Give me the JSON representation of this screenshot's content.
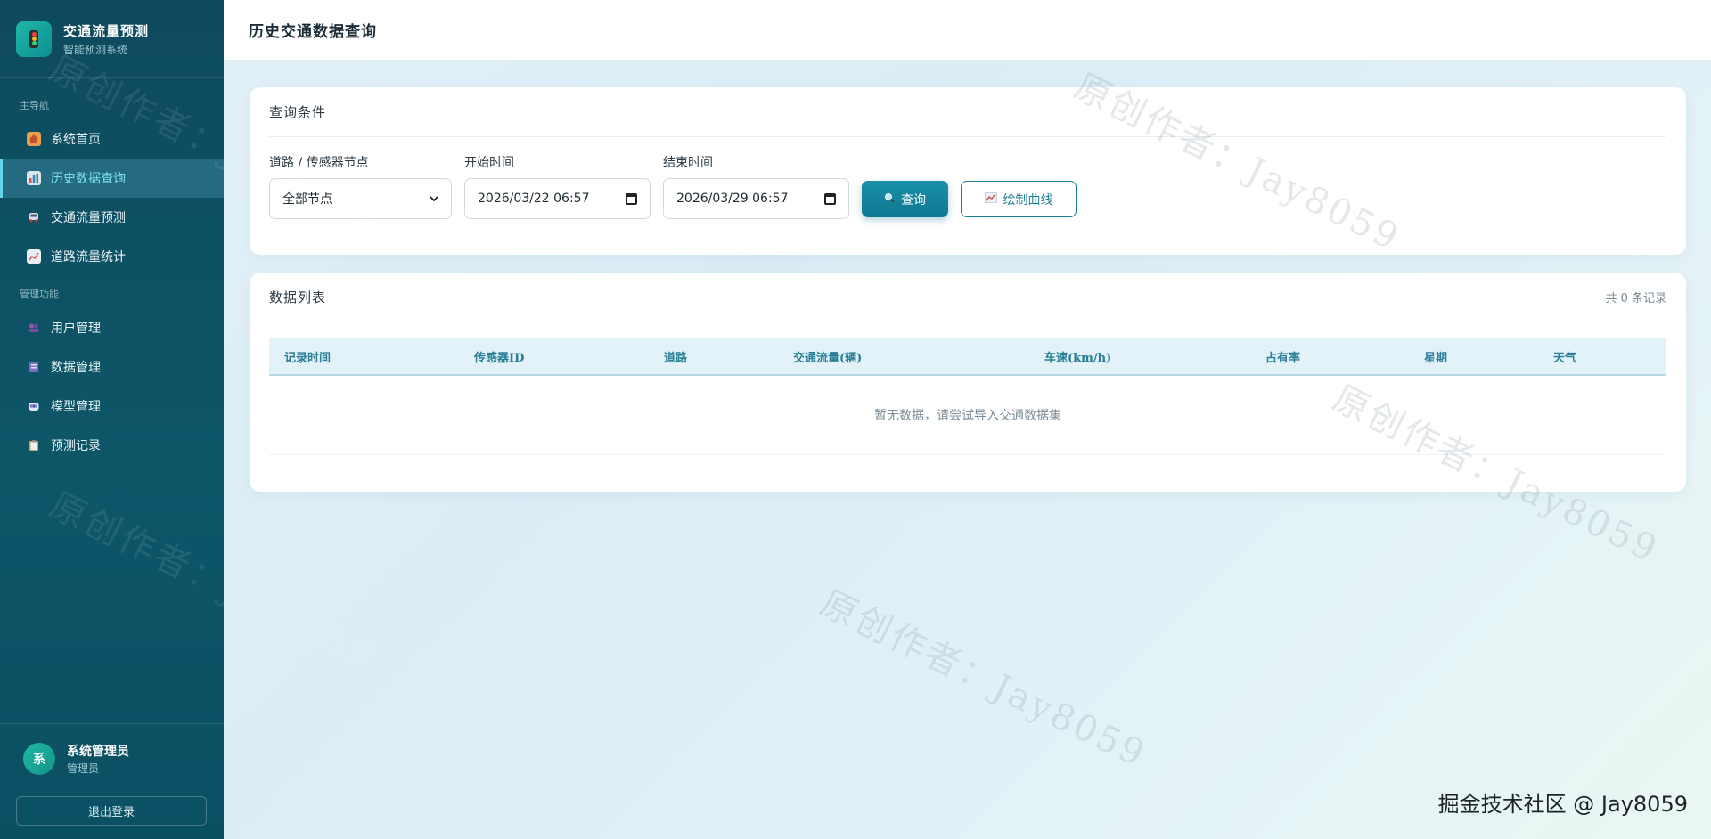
{
  "brand": {
    "title": "交通流量预测",
    "subtitle": "智能预测系统"
  },
  "sidebar": {
    "section_main": "主导航",
    "section_admin": "管理功能",
    "main_items": [
      {
        "label": "系统首页",
        "icon": "house-icon"
      },
      {
        "label": "历史数据查询",
        "icon": "bar-chart-icon",
        "active": true
      },
      {
        "label": "交通流量预测",
        "icon": "car-icon"
      },
      {
        "label": "道路流量统计",
        "icon": "line-chart-icon"
      }
    ],
    "admin_items": [
      {
        "label": "用户管理",
        "icon": "users-icon"
      },
      {
        "label": "数据管理",
        "icon": "database-icon"
      },
      {
        "label": "模型管理",
        "icon": "robot-icon"
      },
      {
        "label": "预测记录",
        "icon": "clipboard-icon"
      }
    ]
  },
  "user": {
    "avatar_text": "系",
    "name": "系统管理员",
    "role": "管理员",
    "logout_label": "退出登录"
  },
  "header": {
    "title": "历史交通数据查询"
  },
  "query": {
    "title": "查询条件",
    "road_label": "道路 / 传感器节点",
    "road_value": "全部节点",
    "start_label": "开始时间",
    "start_value": "2026/03/22 06:57",
    "end_label": "结束时间",
    "end_value": "2026/03/29 06:57",
    "query_button": "查询",
    "plot_button": "绘制曲线"
  },
  "list": {
    "title": "数据列表",
    "count": "共 0 条记录",
    "columns": [
      "记录时间",
      "传感器ID",
      "道路",
      "交通流量(辆)",
      "车速(km/h)",
      "占有率",
      "星期",
      "天气"
    ],
    "empty_text": "暂无数据，请尝试导入交通数据集"
  },
  "watermark": {
    "text": "原创作者：Jay8059",
    "site": "掘金技术社区 @ Jay8059"
  },
  "colors": {
    "accent": "#0f7892",
    "sidebar": "#0e4a5e",
    "active_text": "#7fe3f2"
  }
}
